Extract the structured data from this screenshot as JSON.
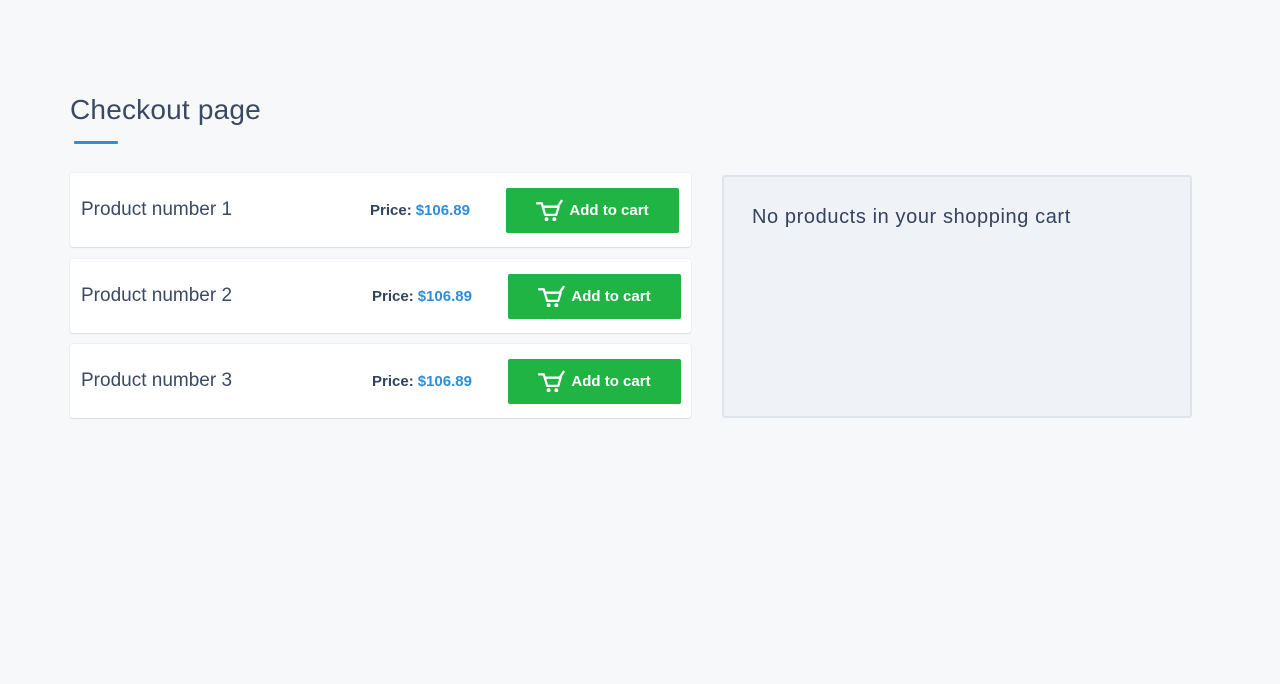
{
  "page": {
    "title": "Checkout page"
  },
  "products": [
    {
      "name": "Product number 1",
      "price_label": "Price:",
      "price": "$106.89",
      "button_label": "Add to cart",
      "button_icon": "cart-icon"
    },
    {
      "name": "Product number 2",
      "price_label": "Price:",
      "price": "$106.89",
      "button_label": "Add to cart",
      "button_icon": "cart-icon"
    },
    {
      "name": "Product number 3",
      "price_label": "Price:",
      "price": "$106.89",
      "button_label": "Add to cart",
      "button_icon": "cart-icon"
    }
  ],
  "cart": {
    "empty_message": "No products in your shopping cart"
  },
  "colors": {
    "accent": "#2f8ddc",
    "button": "#20b444",
    "background": "#f7f8fa",
    "cart_panel": "#eff2f7"
  }
}
